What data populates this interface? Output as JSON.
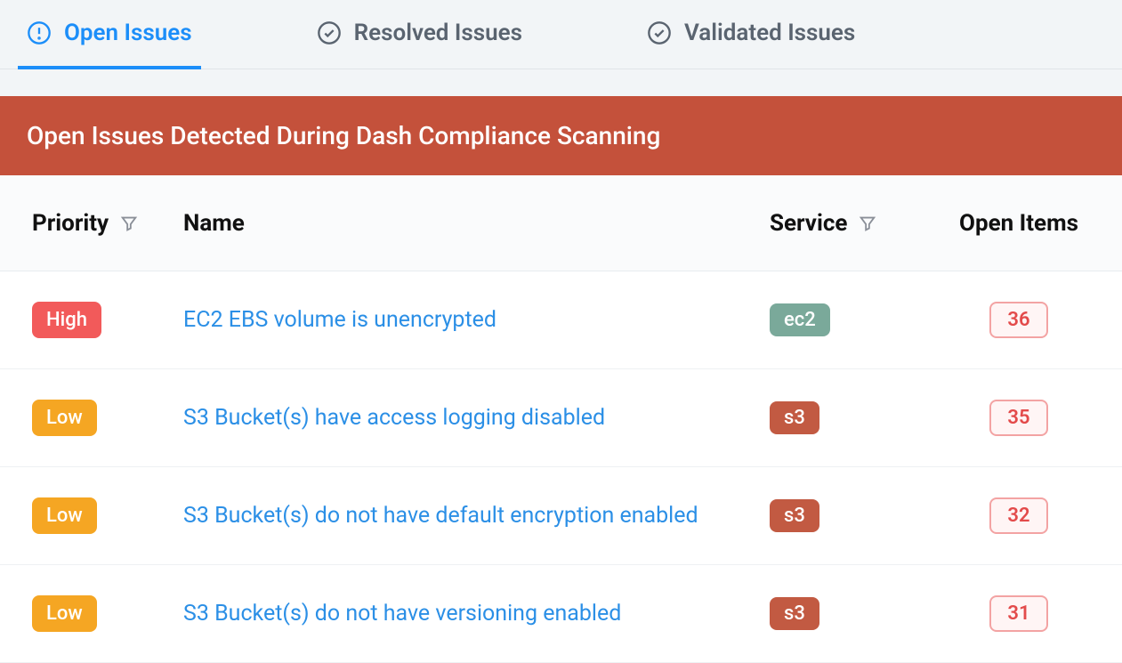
{
  "tabs": {
    "open": {
      "label": "Open Issues"
    },
    "resolved": {
      "label": "Resolved Issues"
    },
    "validated": {
      "label": "Validated Issues"
    }
  },
  "banner": {
    "title": "Open Issues Detected During Dash Compliance Scanning"
  },
  "columns": {
    "priority": "Priority",
    "name": "Name",
    "service": "Service",
    "openItems": "Open Items"
  },
  "issues": [
    {
      "priority": "High",
      "priorityClass": "high",
      "name": "EC2 EBS volume is unencrypted",
      "service": "ec2",
      "serviceClass": "ec2",
      "count": "36"
    },
    {
      "priority": "Low",
      "priorityClass": "low",
      "name": "S3 Bucket(s) have access logging disabled",
      "service": "s3",
      "serviceClass": "s3",
      "count": "35"
    },
    {
      "priority": "Low",
      "priorityClass": "low",
      "name": "S3 Bucket(s) do not have default encryption enabled",
      "service": "s3",
      "serviceClass": "s3",
      "count": "32"
    },
    {
      "priority": "Low",
      "priorityClass": "low",
      "name": "S3 Bucket(s) do not have versioning enabled",
      "service": "s3",
      "serviceClass": "s3",
      "count": "31"
    }
  ]
}
